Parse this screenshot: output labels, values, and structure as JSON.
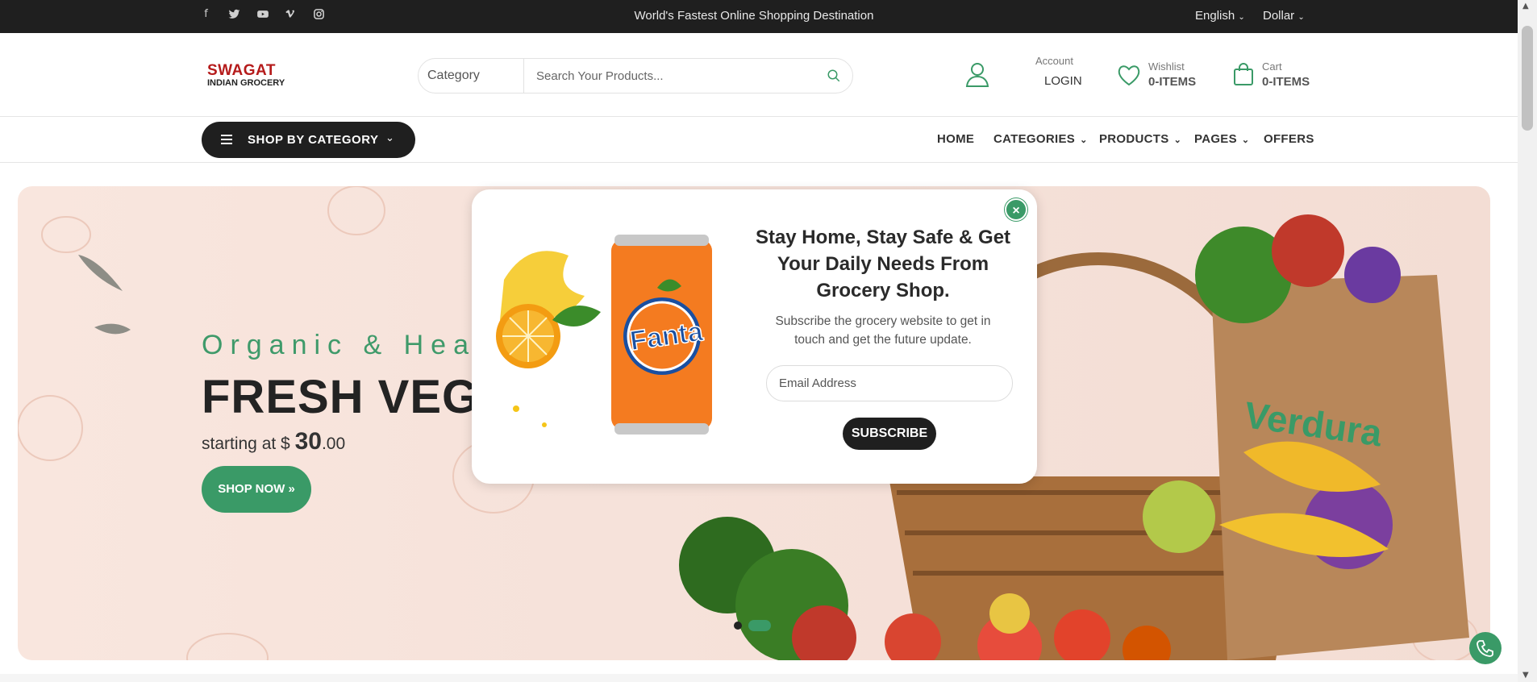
{
  "topbar": {
    "social_icons": [
      "facebook-icon",
      "twitter-icon",
      "youtube-icon",
      "vimeo-icon",
      "instagram-icon"
    ],
    "tagline": "World's Fastest Online Shopping Destination",
    "language": "English",
    "currency": "Dollar"
  },
  "header": {
    "logo_line1": "SWAGAT",
    "logo_line2": "INDIAN GROCERY",
    "search": {
      "category": "Category",
      "placeholder": "Search Your Products..."
    },
    "account": {
      "label": "Account",
      "value": "LOGIN"
    },
    "wishlist": {
      "label": "Wishlist",
      "value": "0-ITEMS"
    },
    "cart": {
      "label": "Cart",
      "value": "0-ITEMS"
    }
  },
  "nav": {
    "shop_by_category": "SHOP BY CATEGORY",
    "items": [
      "HOME",
      "CATEGORIES",
      "PRODUCTS",
      "PAGES",
      "OFFERS"
    ]
  },
  "hero": {
    "subtitle": "Organic & Hea",
    "title": "FRESH VEGET",
    "price_prefix": "starting at $",
    "price_whole": "30",
    "price_cents": ".00",
    "button": "SHOP NOW",
    "button_icon": "double-chevron-right-icon"
  },
  "modal": {
    "heading": "Stay Home, Stay Safe & Get Your Daily Needs From Grocery Shop.",
    "description": "Subscribe the grocery website to get in touch and get the future update.",
    "email_placeholder": "Email Address",
    "subscribe": "SUBSCRIBE",
    "product_brand": "Fanta"
  },
  "colors": {
    "accent": "#3a9a67",
    "dark": "#1f1f1f",
    "hero_bg": "#f6e2da"
  }
}
